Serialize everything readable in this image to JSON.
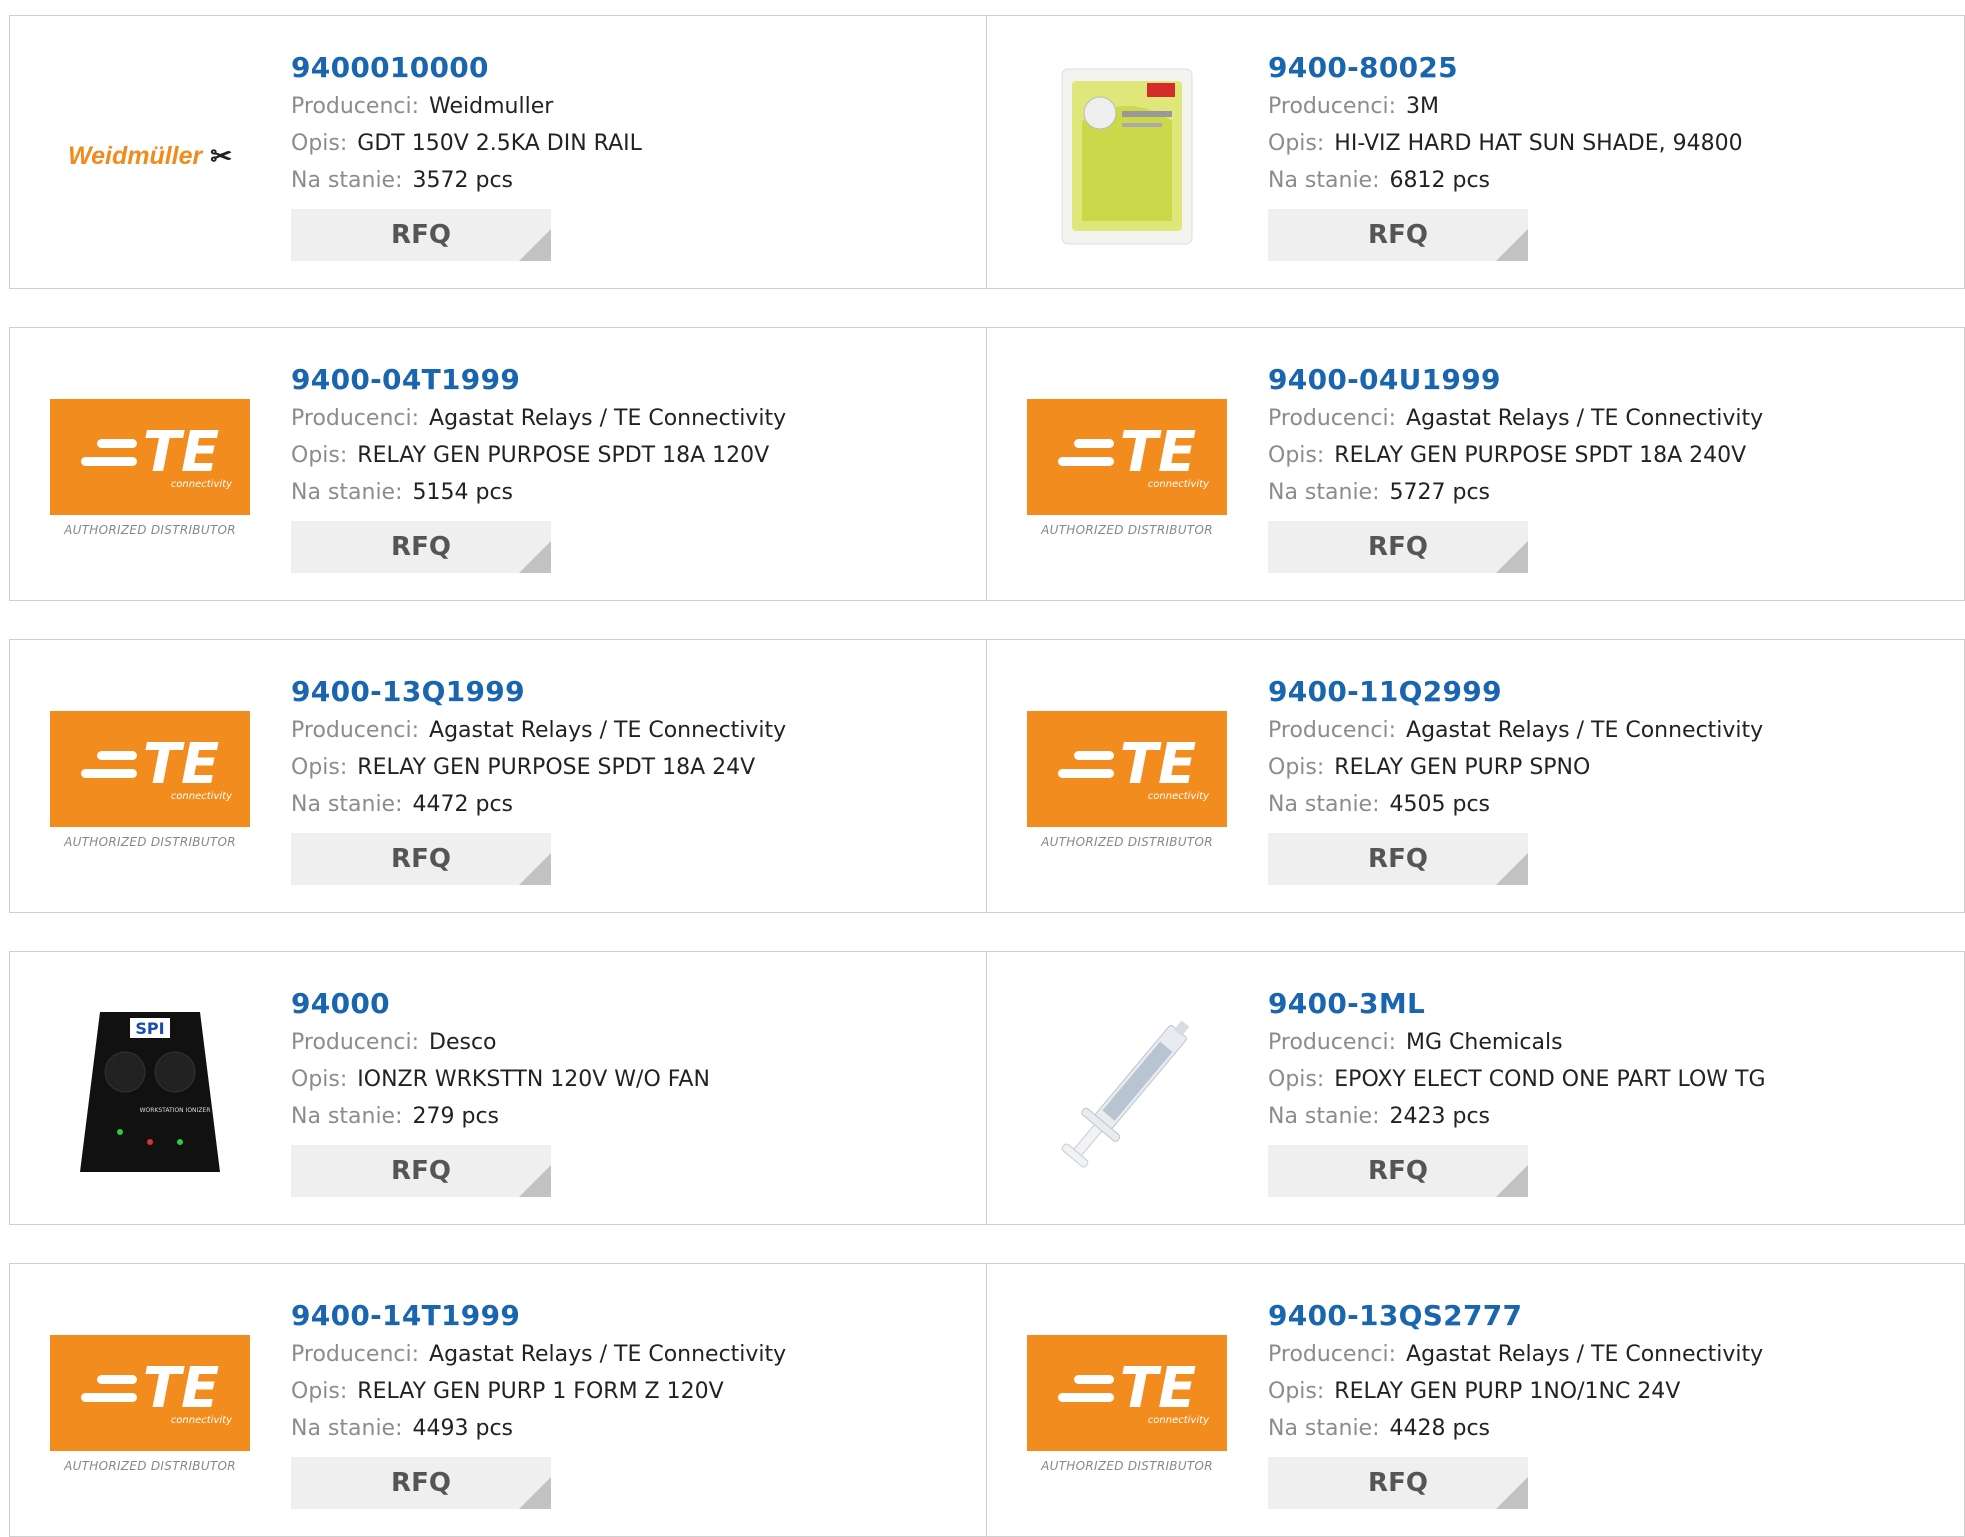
{
  "labels": {
    "manufacturer": "Producenci:",
    "description": "Opis:",
    "stock": "Na stanie:",
    "rfq": "RFQ"
  },
  "te_logo": {
    "brand": "TE",
    "sub": "connectivity",
    "distributor": "AUTHORIZED DISTRIBUTOR"
  },
  "weidmuller_logo": {
    "text": "Weidmüller"
  },
  "spi_logo": {
    "brand": "SPI",
    "label": "WORKSTATION IONIZER"
  },
  "products": [
    {
      "part": "9400010000",
      "manufacturer": "Weidmuller",
      "description": "GDT 150V 2.5KA DIN RAIL",
      "stock": "3572 pcs",
      "image": "weidmuller-logo"
    },
    {
      "part": "9400-80025",
      "manufacturer": "3M",
      "description": "HI-VIZ HARD HAT SUN SHADE, 94800",
      "stock": "6812 pcs",
      "image": "3m-sun-shade-photo"
    },
    {
      "part": "9400-04T1999",
      "manufacturer": "Agastat Relays / TE Connectivity",
      "description": "RELAY GEN PURPOSE SPDT 18A 120V",
      "stock": "5154 pcs",
      "image": "te-logo"
    },
    {
      "part": "9400-04U1999",
      "manufacturer": "Agastat Relays / TE Connectivity",
      "description": "RELAY GEN PURPOSE SPDT 18A 240V",
      "stock": "5727 pcs",
      "image": "te-logo"
    },
    {
      "part": "9400-13Q1999",
      "manufacturer": "Agastat Relays / TE Connectivity",
      "description": "RELAY GEN PURPOSE SPDT 18A 24V",
      "stock": "4472 pcs",
      "image": "te-logo"
    },
    {
      "part": "9400-11Q2999",
      "manufacturer": "Agastat Relays / TE Connectivity",
      "description": "RELAY GEN PURP SPNO",
      "stock": "4505 pcs",
      "image": "te-logo"
    },
    {
      "part": "94000",
      "manufacturer": "Desco",
      "description": "IONZR WRKSTTN 120V W/O FAN",
      "stock": "279 pcs",
      "image": "ionizer-photo"
    },
    {
      "part": "9400-3ML",
      "manufacturer": "MG Chemicals",
      "description": "EPOXY ELECT COND ONE PART LOW TG",
      "stock": "2423 pcs",
      "image": "syringe-photo"
    },
    {
      "part": "9400-14T1999",
      "manufacturer": "Agastat Relays / TE Connectivity",
      "description": "RELAY GEN PURP 1 FORM Z 120V",
      "stock": "4493 pcs",
      "image": "te-logo"
    },
    {
      "part": "9400-13QS2777",
      "manufacturer": "Agastat Relays / TE Connectivity",
      "description": "RELAY GEN PURP 1NO/1NC 24V",
      "stock": "4428 pcs",
      "image": "te-logo"
    }
  ],
  "colors": {
    "link": "#1a65b0",
    "te_orange": "#f28c1f",
    "weid_orange": "#f08c1e",
    "button_bg": "#efefef"
  }
}
